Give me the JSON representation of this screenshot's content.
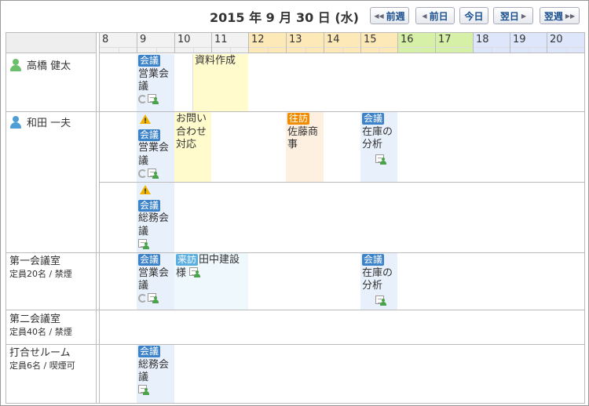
{
  "header": {
    "date_title": "2015 年 9 月 30 日 (水)",
    "nav": {
      "prev_week": "前週",
      "prev_day": "前日",
      "today": "今日",
      "next_day": "翌日",
      "next_week": "翌週"
    }
  },
  "hours": [
    "8",
    "9",
    "10",
    "11",
    "12",
    "13",
    "14",
    "15",
    "16",
    "17",
    "18",
    "19",
    "20"
  ],
  "colors": {
    "meeting_badge": "#3b82c8",
    "visit_out_badge": "#f08c00",
    "visit_in_badge": "#5aaee0",
    "meeting_bg": "#e8f0fb",
    "memo_bg": "#fffbcc",
    "visit_out_bg": "#fdf0e0",
    "visit_in_bg": "#eef8fd",
    "noon_header": "#fde9b8",
    "green_header": "#d7f0a8",
    "blue_header": "#dde6fb",
    "user_green": "#6cc06c",
    "user_blue": "#4f9fd6"
  },
  "rows": {
    "takahashi": {
      "name": "高橋 健太",
      "icon": "user-green-icon"
    },
    "wada": {
      "name": "和田 一夫",
      "icon": "user-blue-icon"
    },
    "room1": {
      "name": "第一会議室",
      "capacity": "定員20名 / 禁煙"
    },
    "room2": {
      "name": "第二会議室",
      "capacity": "定員40名 / 禁煙"
    },
    "room3": {
      "name": "打合せルーム",
      "capacity": "定員6名 / 喫煙可"
    }
  },
  "events": {
    "takahashi_meeting": {
      "badge": "会議",
      "title": "営業会議"
    },
    "takahashi_doc": {
      "title": "資料作成"
    },
    "wada_meeting": {
      "badge": "会議",
      "title": "営業会議"
    },
    "wada_inquiry": {
      "title": "お問い合わせ対応"
    },
    "wada_visit": {
      "badge": "往訪",
      "title": "佐藤商事"
    },
    "wada_inventory": {
      "badge": "会議",
      "title": "在庫の分析"
    },
    "wada_general": {
      "badge": "会議",
      "title": "総務会議"
    },
    "room1_meeting": {
      "badge": "会議",
      "title": "営業会議"
    },
    "room1_visit": {
      "badge": "来訪",
      "title": "田中建設様"
    },
    "room1_inventory": {
      "badge": "会議",
      "title": "在庫の分析"
    },
    "room3_general": {
      "badge": "会議",
      "title": "総務会議"
    }
  }
}
